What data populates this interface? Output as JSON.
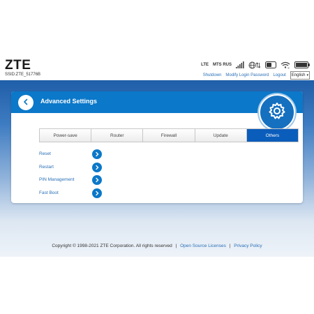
{
  "header": {
    "logo": "ZTE",
    "ssid": "SSID:ZTE_51776B",
    "network_type": "LTE",
    "carrier": "MTS RUS",
    "links": {
      "shutdown": "Shutdown",
      "modify_password": "Modify Login Password",
      "logout": "Logout"
    },
    "language": "English"
  },
  "panel": {
    "title": "Advanced Settings",
    "tabs": [
      {
        "label": "Power-save",
        "active": false
      },
      {
        "label": "Router",
        "active": false
      },
      {
        "label": "Firewall",
        "active": false
      },
      {
        "label": "Update",
        "active": false
      },
      {
        "label": "Others",
        "active": true
      }
    ],
    "items": [
      {
        "label": "Reset"
      },
      {
        "label": "Restart"
      },
      {
        "label": "PIN Management"
      },
      {
        "label": "Fast Boot"
      }
    ]
  },
  "footer": {
    "copyright": "Copyright © 1998-2021 ZTE Corporation. All rights reserved",
    "open_source": "Open Source Licenses",
    "privacy": "Privacy Policy"
  },
  "colors": {
    "accent": "#0b78c9",
    "active_tab": "#0b5dbb",
    "link": "#2a6fb7"
  }
}
